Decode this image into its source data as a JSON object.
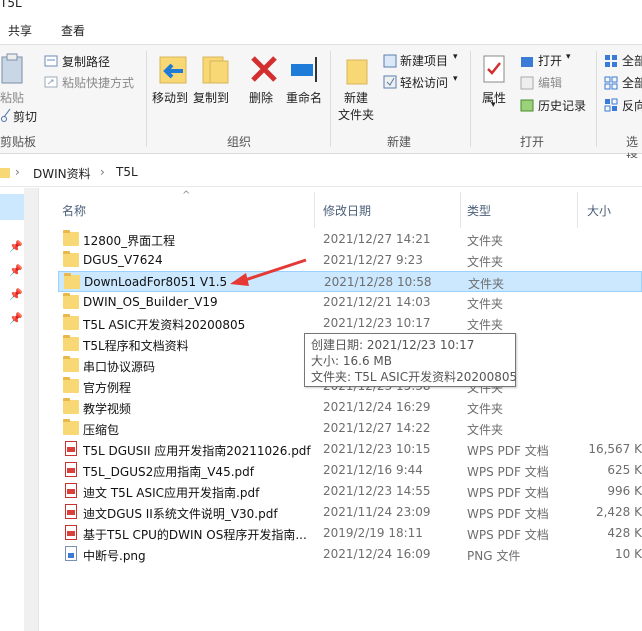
{
  "window": {
    "title_partial": "T5L"
  },
  "tabs": [
    {
      "label": "共享"
    },
    {
      "label": "查看"
    }
  ],
  "ribbon": {
    "clipboard": {
      "paste": "粘贴",
      "copy_path": "复制路径",
      "paste_shortcut": "粘贴快捷方式",
      "cut": "剪切",
      "group": "剪贴板"
    },
    "organize": {
      "move_to": "移动到",
      "copy_to": "复制到",
      "delete": "删除",
      "rename": "重命名",
      "group": "组织"
    },
    "new": {
      "new_folder_1": "新建",
      "new_folder_2": "文件夹",
      "new_item": "新建项目",
      "easy_access": "轻松访问",
      "group": "新建"
    },
    "open": {
      "properties": "属性",
      "open": "打开",
      "edit": "编辑",
      "history": "历史记录",
      "group": "打开"
    },
    "select": {
      "select_all": "全部",
      "select_none": "全部",
      "invert": "反向",
      "group": "选择"
    }
  },
  "address": {
    "crumbs": [
      "DWIN资料",
      "T5L"
    ]
  },
  "columns": {
    "name": "名称",
    "date": "修改日期",
    "type": "类型",
    "size": "大小"
  },
  "files": [
    {
      "name": "12800_界面工程",
      "date": "2021/12/27 14:21",
      "type": "文件夹",
      "size": "",
      "kind": "folder"
    },
    {
      "name": "DGUS_V7624",
      "date": "2021/12/27 9:23",
      "type": "文件夹",
      "size": "",
      "kind": "folder"
    },
    {
      "name": "DownLoadFor8051 V1.5",
      "date": "2021/12/28 10:58",
      "type": "文件夹",
      "size": "",
      "kind": "folder",
      "selected": true
    },
    {
      "name": "DWIN_OS_Builder_V19",
      "date": "2021/12/21 14:03",
      "type": "文件夹",
      "size": "",
      "kind": "folder"
    },
    {
      "name": "T5L ASIC开发资料20200805",
      "date": "2021/12/23 10:17",
      "type": "文件夹",
      "size": "",
      "kind": "folder"
    },
    {
      "name": "T5L程序和文档资料",
      "date": "2021/12/23 14:22",
      "type": "文件夹",
      "size": "",
      "kind": "folder"
    },
    {
      "name": "串口协议源码",
      "date": "2021/12/23 14:55",
      "type": "文件夹",
      "size": "",
      "kind": "folder"
    },
    {
      "name": "官方例程",
      "date": "2021/12/23 15:38",
      "type": "文件夹",
      "size": "",
      "kind": "folder"
    },
    {
      "name": "教学视频",
      "date": "2021/12/24 16:29",
      "type": "文件夹",
      "size": "",
      "kind": "folder"
    },
    {
      "name": "压缩包",
      "date": "2021/12/27 14:22",
      "type": "文件夹",
      "size": "",
      "kind": "folder"
    },
    {
      "name": "T5L DGUSII 应用开发指南20211026.pdf",
      "date": "2021/12/23 10:15",
      "type": "WPS PDF 文档",
      "size": "16,567 K",
      "kind": "pdf"
    },
    {
      "name": "T5L_DGUS2应用指南_V45.pdf",
      "date": "2021/12/16 9:44",
      "type": "WPS PDF 文档",
      "size": "625 K",
      "kind": "pdf"
    },
    {
      "name": "迪文 T5L ASIC应用开发指南.pdf",
      "date": "2021/12/23 14:55",
      "type": "WPS PDF 文档",
      "size": "996 K",
      "kind": "pdf"
    },
    {
      "name": "迪文DGUS II系统文件说明_V30.pdf",
      "date": "2021/11/24 23:09",
      "type": "WPS PDF 文档",
      "size": "2,428 K",
      "kind": "pdf"
    },
    {
      "name": "基于T5L CPU的DWIN OS程序开发指南...",
      "date": "2019/2/19 18:11",
      "type": "WPS PDF 文档",
      "size": "428 K",
      "kind": "pdf"
    },
    {
      "name": "中断号.png",
      "date": "2021/12/24 16:09",
      "type": "PNG 文件",
      "size": "10 K",
      "kind": "png"
    }
  ],
  "tooltip": {
    "created": "创建日期: 2021/12/23 10:17",
    "size": "大小: 16.6 MB",
    "folders": "文件夹: T5L ASIC开发资料20200805"
  },
  "colors": {
    "selection": "#cce8ff",
    "selection_border": "#99d1ff",
    "folder": "#f8d775",
    "arrow": "#e53935",
    "delete_x": "#d32f2f"
  }
}
